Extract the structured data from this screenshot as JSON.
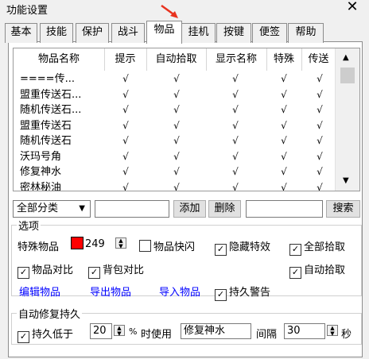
{
  "window": {
    "title": "功能设置",
    "close_glyph": "✕"
  },
  "tabs": [
    "基本",
    "技能",
    "保护",
    "战斗",
    "物品",
    "挂机",
    "按键",
    "便签",
    "帮助"
  ],
  "item_table": {
    "headers": [
      "物品名称",
      "提示",
      "自动拾取",
      "显示名称",
      "特殊",
      "传送"
    ],
    "rows": [
      {
        "name": "====传...",
        "checks": [
          "√",
          "√",
          "√",
          "√",
          "√"
        ]
      },
      {
        "name": "盟重传送石...",
        "checks": [
          "√",
          "√",
          "√",
          "√",
          "√"
        ]
      },
      {
        "name": "随机传送石...",
        "checks": [
          "√",
          "√",
          "√",
          "√",
          "√"
        ]
      },
      {
        "name": "盟重传送石",
        "checks": [
          "√",
          "√",
          "√",
          "√",
          "√"
        ]
      },
      {
        "name": "随机传送石",
        "checks": [
          "√",
          "√",
          "√",
          "√",
          "√"
        ]
      },
      {
        "name": "沃玛号角",
        "checks": [
          "√",
          "√",
          "√",
          "√",
          "√"
        ]
      },
      {
        "name": "修复神水",
        "checks": [
          "√",
          "√",
          "√",
          "√",
          "√"
        ]
      },
      {
        "name": "密林秘油",
        "checks": [
          "√",
          "√",
          "√",
          "√",
          "√"
        ]
      }
    ]
  },
  "filter": {
    "category": "全部分类",
    "add_label": "添加",
    "delete_label": "删除",
    "search_label": "搜索"
  },
  "options": {
    "group_title": "选项",
    "special_item_label": "特殊物品",
    "special_color": "#ff0000",
    "special_value": "249",
    "item_flash": "物品快闪",
    "hide_effect": "隐藏特效",
    "pick_all": "全部拾取",
    "item_compare": "物品对比",
    "bag_compare": "背包对比",
    "auto_pick": "自动拾取",
    "edit_items": "编辑物品",
    "export_items": "导出物品",
    "import_items": "导入物品",
    "durability_warn": "持久警告"
  },
  "repair": {
    "group_title": "自动修复持久",
    "durability_below": "持久低于",
    "percent_value": "20",
    "percent_sign": "%",
    "use_when": "时使用",
    "repair_item": "修复神水",
    "interval_label": "间隔",
    "interval_value": "30",
    "seconds": "秒"
  }
}
